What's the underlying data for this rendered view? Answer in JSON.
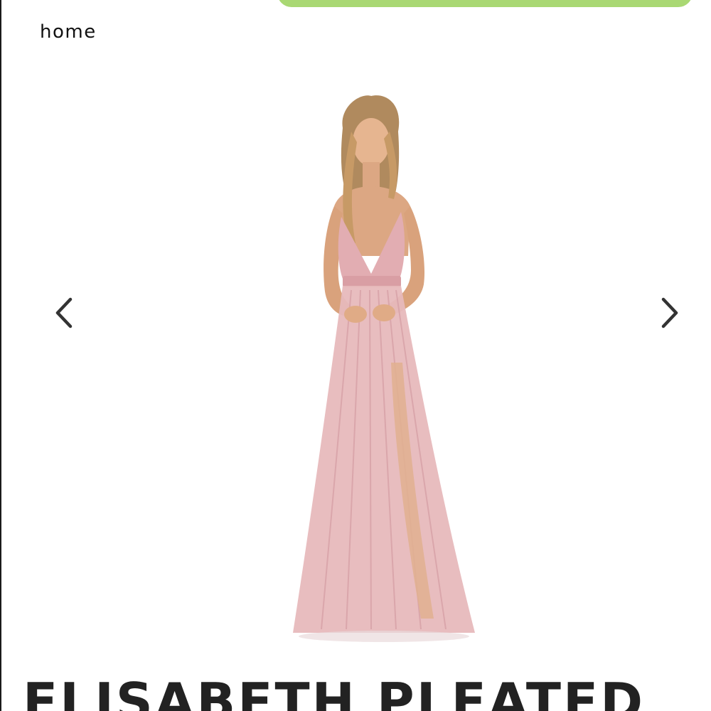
{
  "header": {
    "home_label": "home"
  },
  "carousel": {
    "prev_icon": "chevron-left-icon",
    "next_icon": "chevron-right-icon",
    "image_subject": "model wearing pink pleated tulle maxi dress"
  },
  "product": {
    "title": "ELISABETH PLEATED"
  },
  "colors": {
    "accent_pill": "#a9d873",
    "dress": "#e3b2b5",
    "text": "#222222"
  }
}
